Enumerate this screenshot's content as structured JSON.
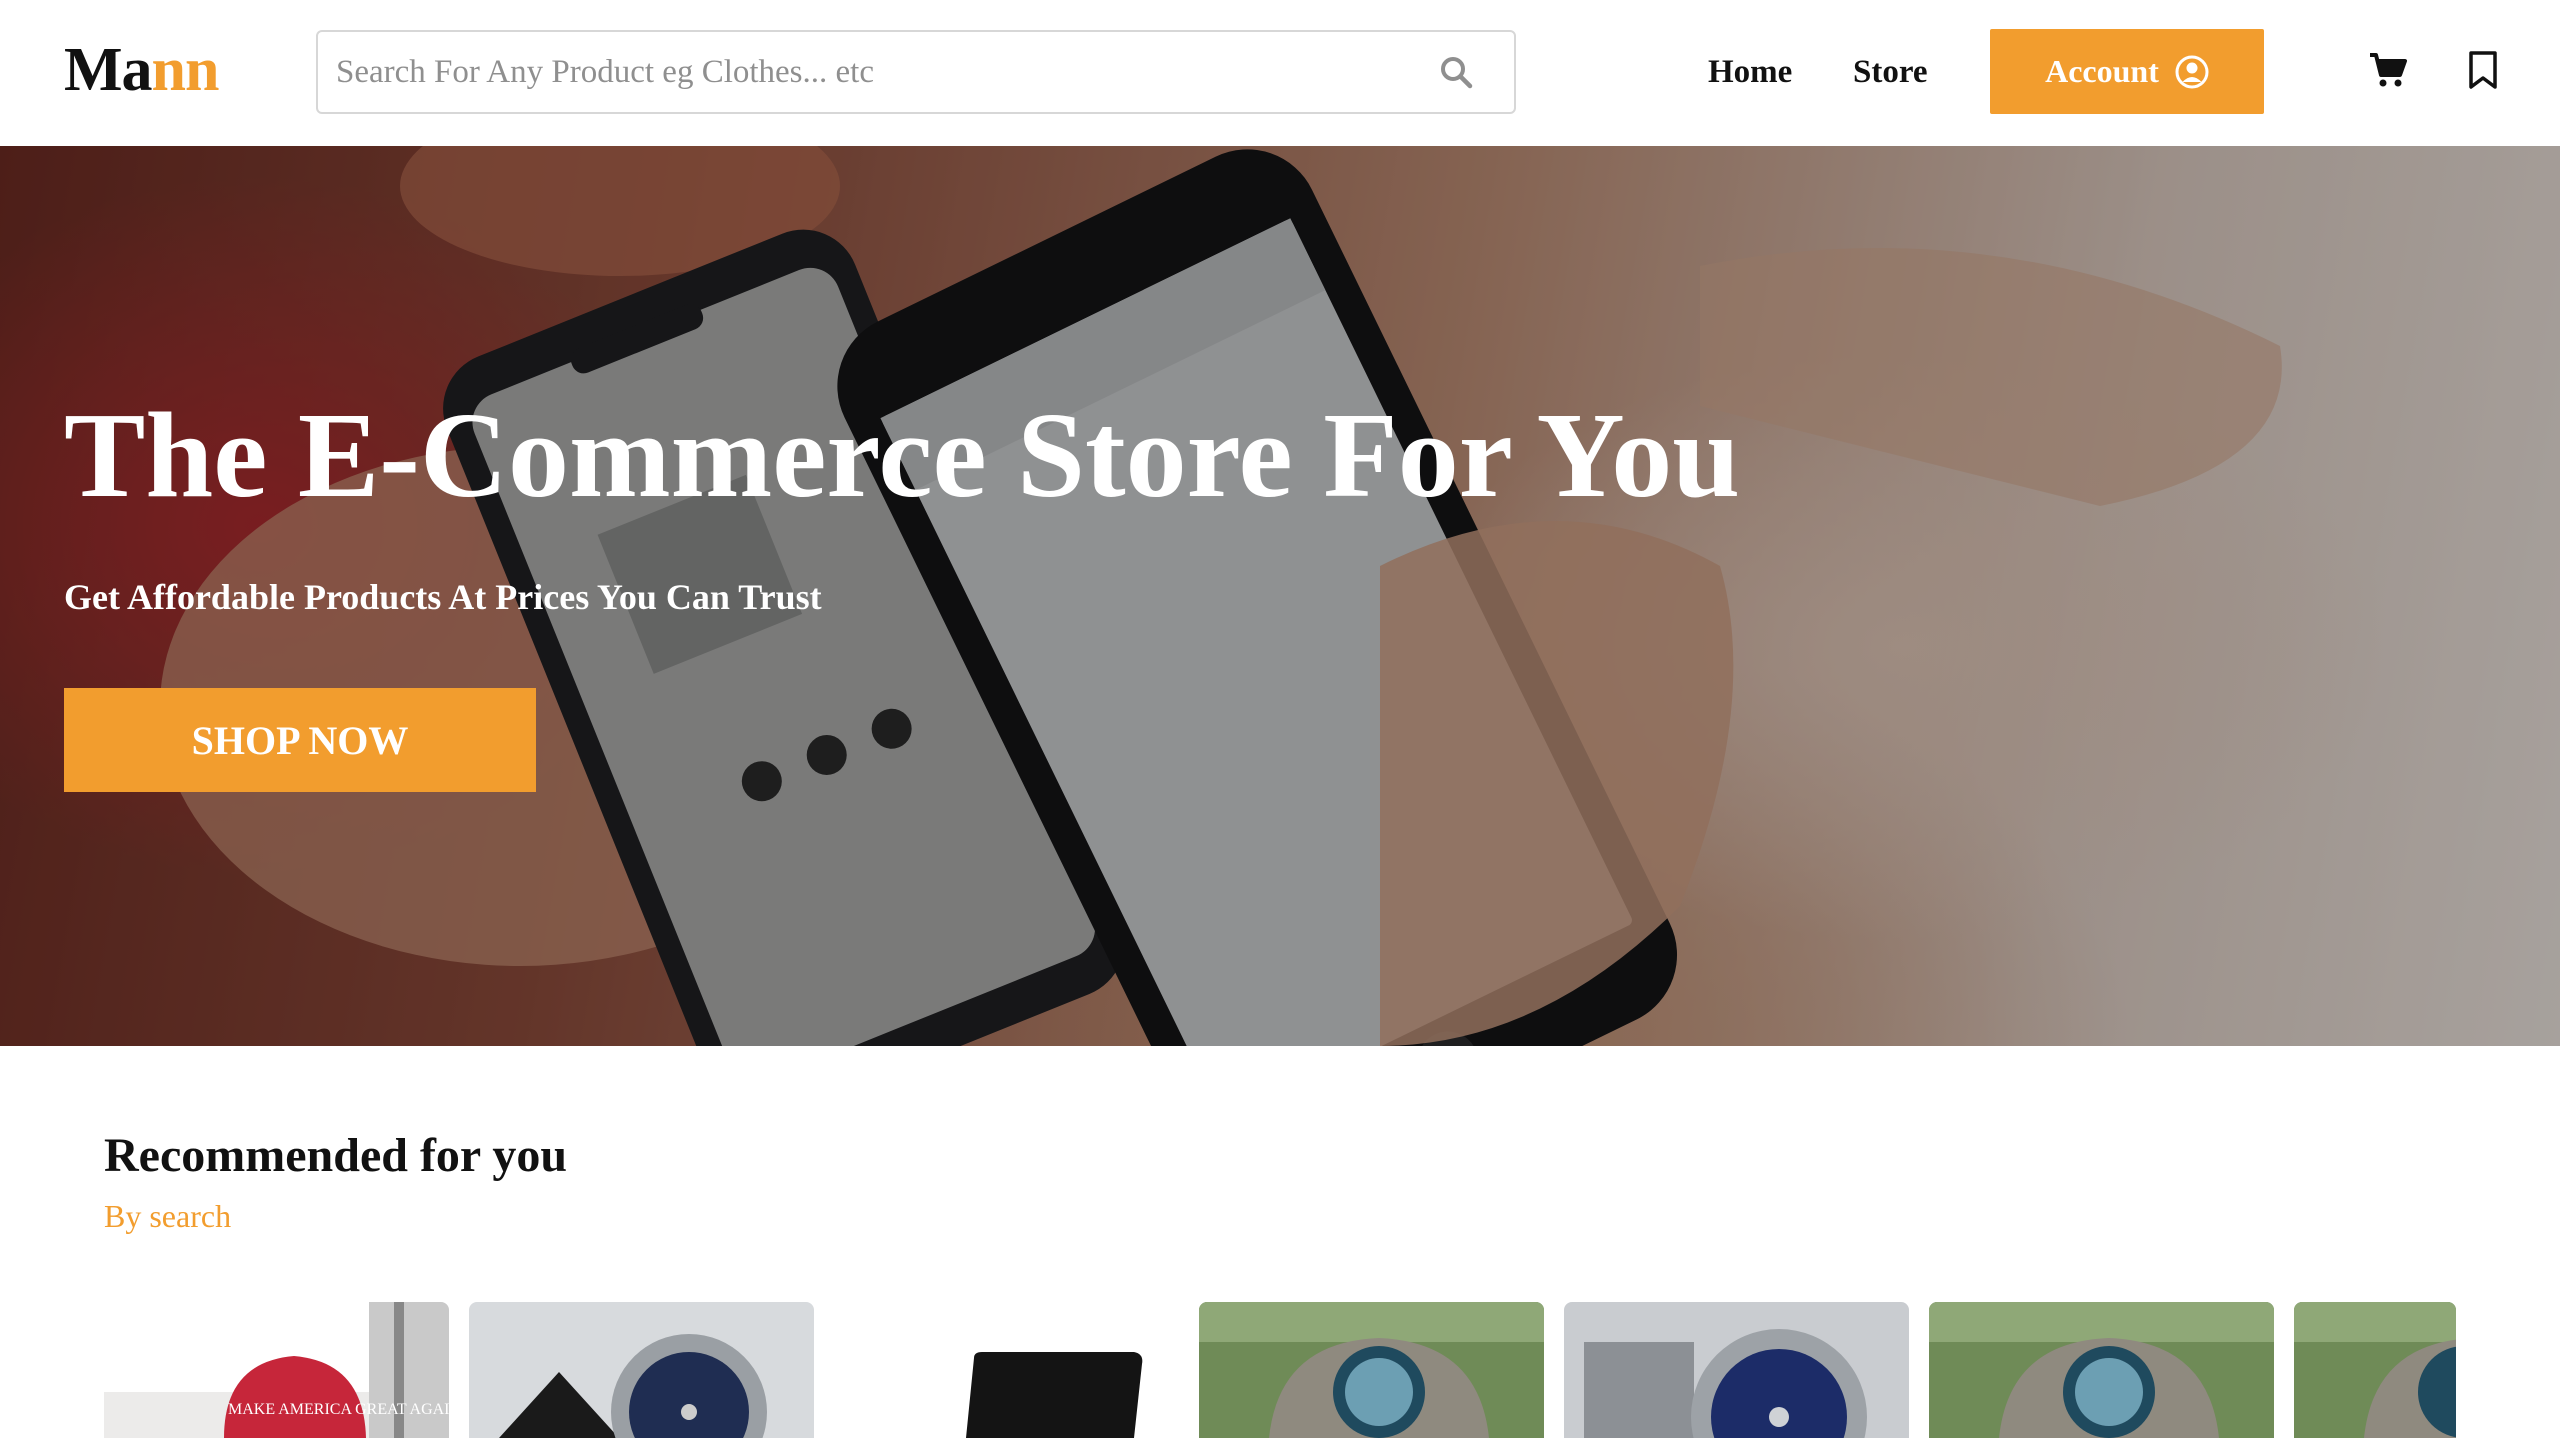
{
  "brand": {
    "logo_main": "Ma",
    "logo_accent": "nn",
    "accent_color": "#f29d2e"
  },
  "search": {
    "placeholder": "Search For Any Product eg Clothes... etc",
    "value": "",
    "icon": "search-icon"
  },
  "nav": {
    "home_label": "Home",
    "store_label": "Store",
    "account_label": "Account",
    "account_icon": "user-circle-icon",
    "cart_icon": "cart-icon",
    "bookmark_icon": "bookmark-icon"
  },
  "hero": {
    "title": "The E-Commerce Store For You",
    "subtitle": "Get Affordable Products At Prices You Can Trust",
    "cta_label": "SHOP NOW",
    "cap_text": "MAKE AMERICA GREAT AGAIN"
  },
  "recommended": {
    "title": "Recommended for you",
    "subtitle": "By search",
    "products": [
      {
        "image": "red-cap"
      },
      {
        "image": "steel-watch"
      },
      {
        "image": "black-wallet"
      },
      {
        "image": "trucker-cap"
      },
      {
        "image": "chronograph-watch"
      },
      {
        "image": "trucker-cap"
      },
      {
        "image": "trucker-cap"
      }
    ]
  }
}
